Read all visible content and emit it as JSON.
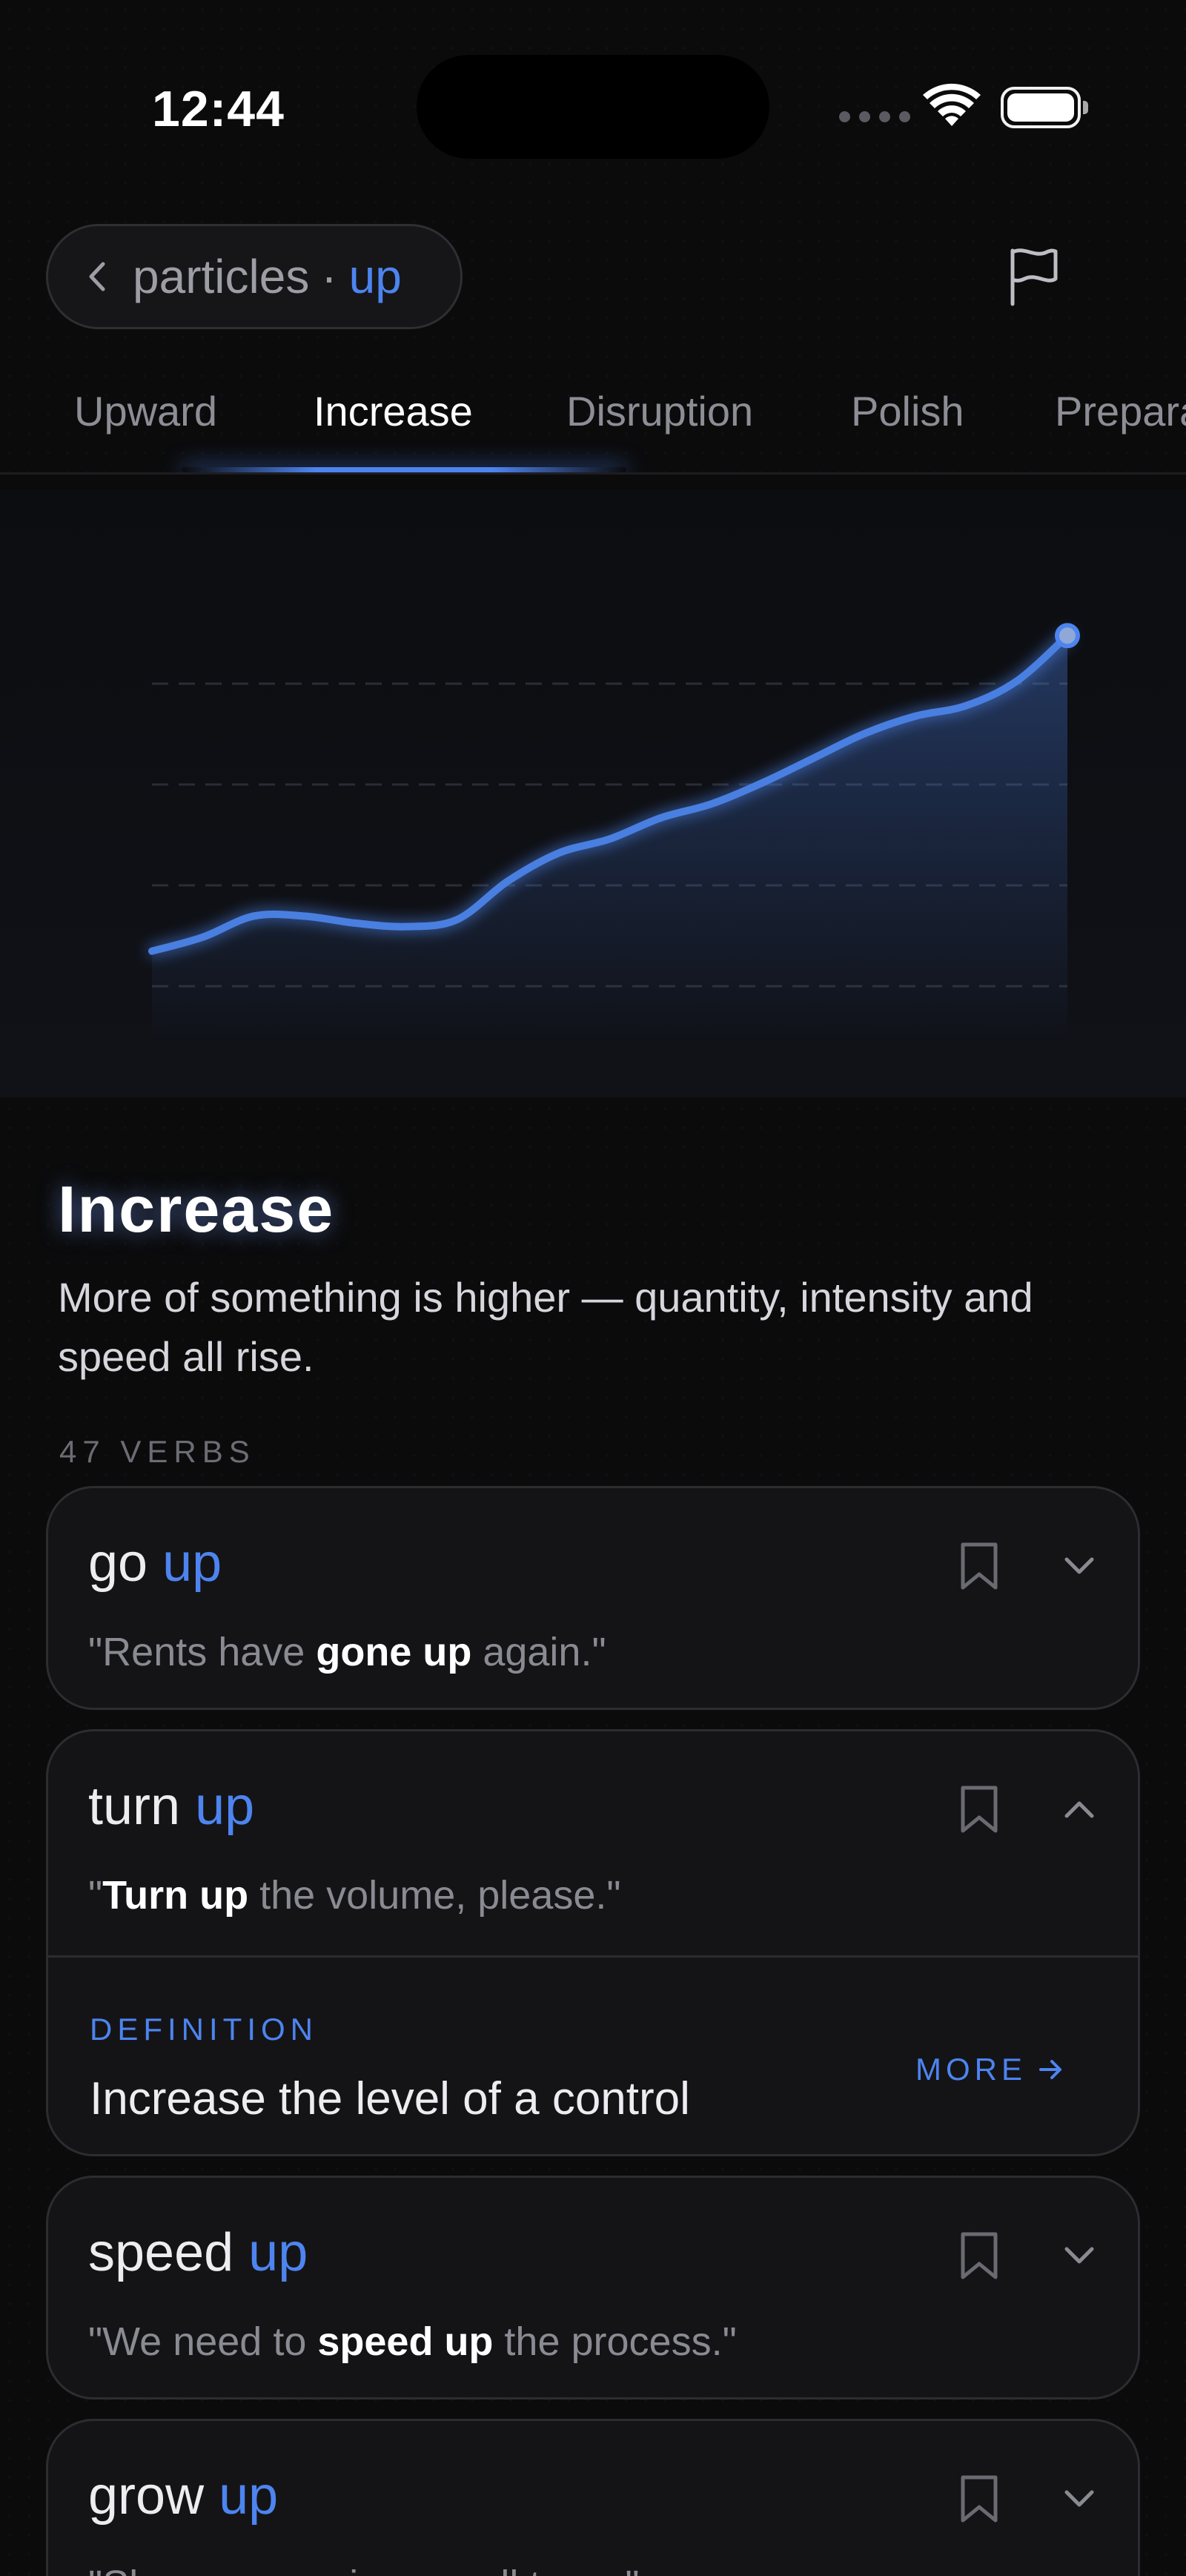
{
  "status_bar": {
    "time": "12:44"
  },
  "header": {
    "crumb_parent": "particles",
    "crumb_sep": "·",
    "crumb_current": "up",
    "accent": "#4d84ef"
  },
  "tabs": [
    {
      "label": "Upward"
    },
    {
      "label": "Increase",
      "active": true
    },
    {
      "label": "Disruption"
    },
    {
      "label": "Polish"
    },
    {
      "label": "Prepara"
    }
  ],
  "chart_data": {
    "type": "line",
    "title": "",
    "xlabel": "",
    "ylabel": "",
    "grid": true,
    "series": [
      {
        "values": [
          0.1,
          0.14,
          0.2,
          0.2,
          0.18,
          0.17,
          0.19,
          0.3,
          0.38,
          0.42,
          0.48,
          0.52,
          0.58,
          0.65,
          0.72,
          0.77,
          0.8,
          0.87,
          1.0
        ]
      }
    ],
    "ylim": [
      0,
      1.1
    ]
  },
  "section": {
    "title": "Increase",
    "description": "More of something is higher — quantity, intensity and speed all rise.",
    "count": "47 VERBS"
  },
  "cards": [
    {
      "verb": "go",
      "particle": "up",
      "ex_pre": "\"Rents have ",
      "ex_bold": "gone up",
      "ex_post": " again.\"",
      "expanded": false
    },
    {
      "verb": "turn",
      "particle": "up",
      "ex_pre": "\"",
      "ex_bold": "Turn up",
      "ex_post": " the volume, please.\"",
      "expanded": true,
      "def_label": "DEFINITION",
      "definition": "Increase the level of a control",
      "more": "MORE"
    },
    {
      "verb": "speed",
      "particle": "up",
      "ex_pre": "\"We need to ",
      "ex_bold": "speed up",
      "ex_post": " the process.\"",
      "expanded": false
    },
    {
      "verb": "grow",
      "particle": "up",
      "ex_pre": "\"She ",
      "ex_bold": "grew up",
      "ex_post": " in a small town.\"",
      "expanded": false
    }
  ]
}
